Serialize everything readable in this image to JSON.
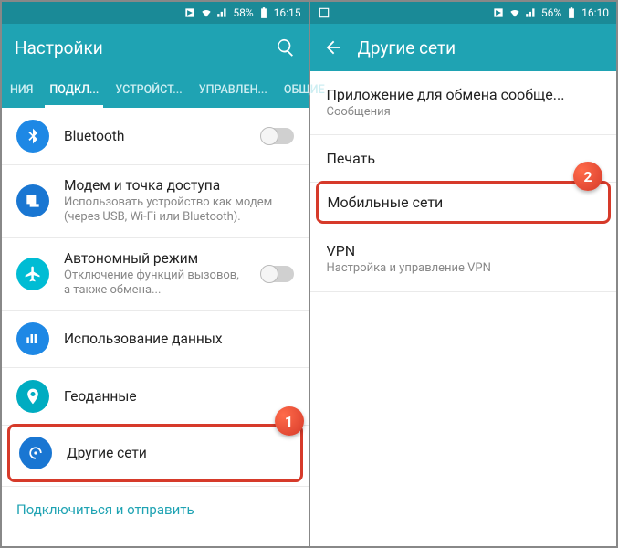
{
  "left": {
    "status": {
      "battery": "58%",
      "time": "16:15"
    },
    "appbar": {
      "title": "Настройки"
    },
    "tabs": [
      {
        "label": "НИЯ",
        "active": false
      },
      {
        "label": "ПОДКЛ...",
        "active": true
      },
      {
        "label": "УСТРОЙСТ...",
        "active": false
      },
      {
        "label": "УПРАВЛЕН...",
        "active": false
      },
      {
        "label": "ОБЩИЕ",
        "active": false
      }
    ],
    "rows": {
      "bluetooth": {
        "title": "Bluetooth"
      },
      "tether": {
        "title": "Модем и точка доступа",
        "subtitle": "Использовать устройство как модем (через USB, Wi-Fi или Bluetooth)."
      },
      "airplane": {
        "title": "Автономный режим",
        "subtitle": "Отключение функций вызовов, а также обмена..."
      },
      "data": {
        "title": "Использование данных"
      },
      "geo": {
        "title": "Геоданные"
      },
      "other": {
        "title": "Другие сети"
      }
    },
    "footer_link": "Подключиться и отправить",
    "callout": "1"
  },
  "right": {
    "status": {
      "battery": "56%",
      "time": "16:10"
    },
    "appbar": {
      "title": "Другие сети"
    },
    "rows": {
      "msgapp": {
        "title": "Приложение для обмена сообще...",
        "subtitle": "Сообщения"
      },
      "print": {
        "title": "Печать"
      },
      "mobile": {
        "title": "Мобильные сети"
      },
      "vpn": {
        "title": "VPN",
        "subtitle": "Настройка и управление VPN"
      }
    },
    "callout": "2"
  }
}
